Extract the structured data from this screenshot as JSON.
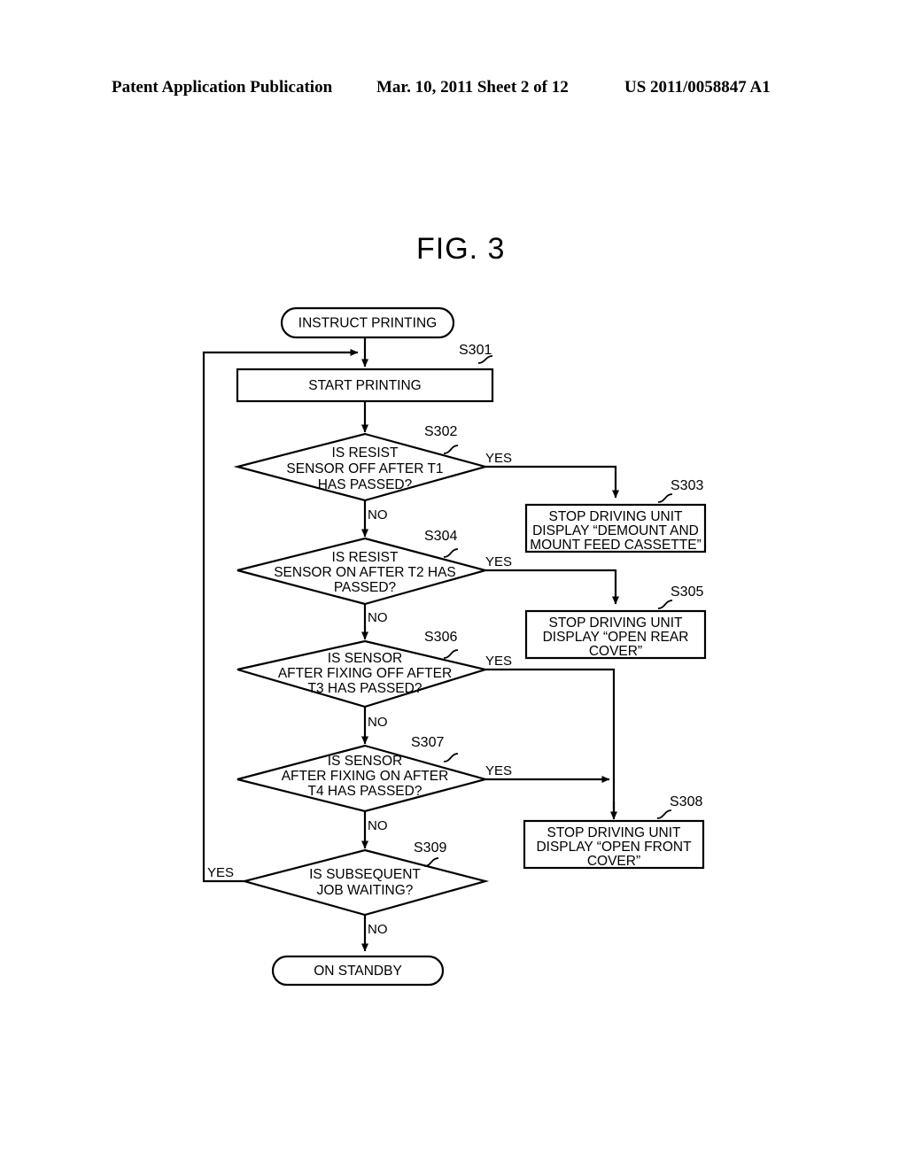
{
  "header": {
    "left": "Patent Application Publication",
    "middle": "Mar. 10, 2011  Sheet 2 of 12",
    "right": "US 2011/0058847 A1"
  },
  "figure": {
    "title": "FIG. 3"
  },
  "flowchart": {
    "terminals": [
      {
        "id": "start",
        "label": "INSTRUCT PRINTING"
      },
      {
        "id": "end",
        "label": "ON STANDBY"
      }
    ],
    "processes": [
      {
        "step": "S301",
        "lines": [
          "START PRINTING"
        ]
      },
      {
        "step": "S303",
        "lines": [
          "STOP DRIVING UNIT",
          "DISPLAY “DEMOUNT AND",
          "MOUNT FEED CASSETTE”"
        ]
      },
      {
        "step": "S305",
        "lines": [
          "STOP DRIVING UNIT",
          "DISPLAY “OPEN REAR",
          "COVER”"
        ]
      },
      {
        "step": "S308",
        "lines": [
          "STOP DRIVING UNIT",
          "DISPLAY “OPEN FRONT",
          "COVER”"
        ]
      }
    ],
    "decisions": [
      {
        "step": "S302",
        "lines": [
          "IS RESIST",
          "SENSOR OFF AFTER T1",
          "HAS PASSED?"
        ],
        "yes": "YES",
        "no": "NO"
      },
      {
        "step": "S304",
        "lines": [
          "IS RESIST",
          "SENSOR ON AFTER T2 HAS",
          "PASSED?"
        ],
        "yes": "YES",
        "no": "NO"
      },
      {
        "step": "S306",
        "lines": [
          "IS SENSOR",
          "AFTER FIXING OFF AFTER",
          "T3 HAS PASSED?"
        ],
        "yes": "YES",
        "no": "NO"
      },
      {
        "step": "S307",
        "lines": [
          "IS SENSOR",
          "AFTER FIXING ON AFTER",
          "T4 HAS PASSED?"
        ],
        "yes": "YES",
        "no": "NO"
      },
      {
        "step": "S309",
        "lines": [
          "IS SUBSEQUENT",
          "JOB WAITING?"
        ],
        "yes": "YES",
        "no": "NO"
      }
    ]
  }
}
